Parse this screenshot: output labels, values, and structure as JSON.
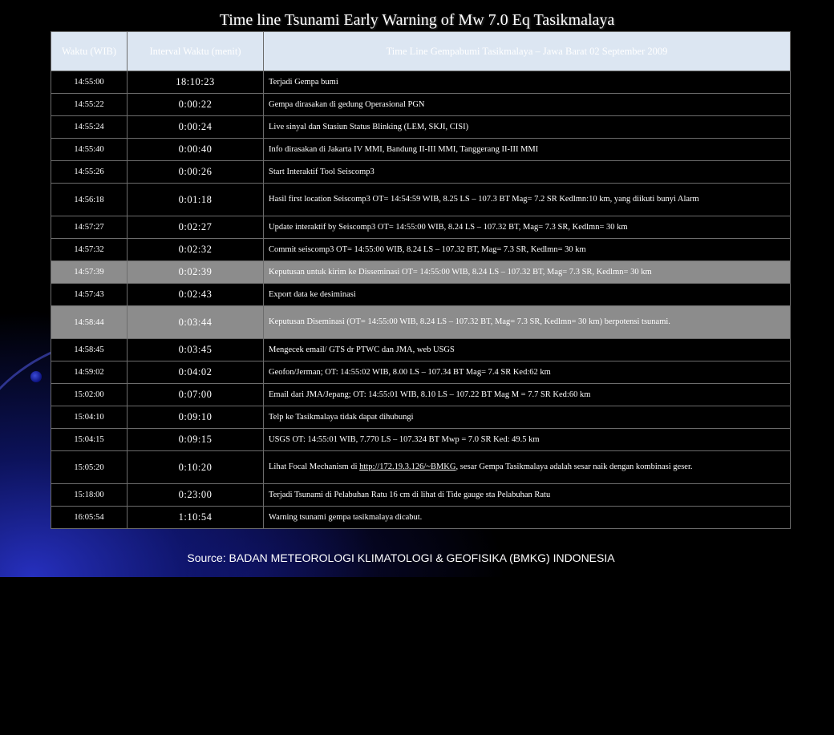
{
  "title": "Time line Tsunami Early Warning of Mw 7.0 Eq Tasikmalaya",
  "source": "Source: BADAN METEOROLOGI KLIMATOLOGI & GEOFISIKA  (BMKG) INDONESIA",
  "header": {
    "col_time": "Waktu (WIB)",
    "col_interval": "Interval Waktu (menit)",
    "col_event": "Time Line Gempabumi Tasikmalaya  – Jawa Barat 02 September 2009"
  },
  "rows": [
    {
      "time": "14:55:00",
      "interval": "18:10:23",
      "event": "Terjadi Gempa bumi"
    },
    {
      "time": "14:55:22",
      "interval": "0:00:22",
      "event": "Gempa dirasakan di gedung Operasional PGN"
    },
    {
      "time": "14:55:24",
      "interval": "0:00:24",
      "event": "Live sinyal dan Stasiun Status Blinking (LEM, SKJI, CISI)"
    },
    {
      "time": "14:55:40",
      "interval": "0:00:40",
      "event": "Info dirasakan di Jakarta IV MMI, Bandung II-III MMI, Tanggerang II-III MMI"
    },
    {
      "time": "14:55:26",
      "interval": "0:00:26",
      "event": "Start Interaktif Tool Seiscomp3"
    },
    {
      "time": "14:56:18",
      "interval": "0:01:18",
      "event": "Hasil first location Seiscomp3 OT= 14:54:59 WIB, 8.25 LS – 107.3 BT Mag= 7.2 SR Kedlmn:10 km, yang diikuti bunyi Alarm"
    },
    {
      "time": "14:57:27",
      "interval": "0:02:27",
      "event": "Update interaktif by Seiscomp3 OT= 14:55:00 WIB, 8.24 LS – 107.32 BT, Mag= 7.3 SR, Kedlmn= 30 km"
    },
    {
      "time": "14:57:32",
      "interval": "0:02:32",
      "event": "Commit seiscomp3 OT= 14:55:00 WIB, 8.24 LS – 107.32 BT, Mag= 7.3 SR, Kedlmn= 30 km"
    },
    {
      "time": "14:57:39",
      "interval": "0:02:39",
      "event": "Keputusan untuk kirim ke Disseminasi OT= 14:55:00 WIB, 8.24 LS – 107.32 BT, Mag= 7.3 SR, Kedlmn= 30 km"
    },
    {
      "time": "14:57:43",
      "interval": "0:02:43",
      "event": "Export data ke desiminasi"
    },
    {
      "time": "14:58:44",
      "interval": "0:03:44",
      "event": "Keputusan Diseminasi (OT= 14:55:00 WIB, 8.24 LS – 107.32 BT, Mag= 7.3 SR, Kedlmn= 30 km) berpotensi tsunami."
    },
    {
      "time": "14:58:45",
      "interval": "0:03:45",
      "event": "Mengecek email/ GTS dr PTWC dan JMA, web USGS"
    },
    {
      "time": "14:59:02",
      "interval": "0:04:02",
      "event": "Geofon/Jerman; OT: 14:55:02 WIB, 8.00 LS – 107.34 BT Mag= 7.4 SR Ked:62 km"
    },
    {
      "time": "15:02:00",
      "interval": "0:07:00",
      "event": "Email dari JMA/Jepang; OT: 14:55:01 WIB, 8.10 LS – 107.22 BT Mag M = 7.7 SR Ked:60  km"
    },
    {
      "time": "15:04:10",
      "interval": "0:09:10",
      "event": "Telp ke Tasikmalaya tidak dapat dihubungi"
    },
    {
      "time": "15:04:15",
      "interval": "0:09:15",
      "event": "USGS OT: 14:55:01 WIB, 7.770 LS – 107.324 BT Mwp = 7.0 SR Ked: 49.5 km"
    },
    {
      "time": "15:05:20",
      "interval": "0:10:20",
      "event_pre": "Lihat Focal Mechanism di ",
      "event_link": "http://172.19.3.126/~BMKG",
      "event_post": ", sesar Gempa Tasikmalaya adalah sesar naik dengan kombinasi geser."
    },
    {
      "time": "15:18:00",
      "interval": "0:23:00",
      "event": "Terjadi Tsunami di Pelabuhan Ratu 16 cm di lihat di Tide gauge sta Pelabuhan Ratu"
    },
    {
      "time": "16:05:54",
      "interval": "1:10:54",
      "event": "Warning tsunami gempa tasikmalaya dicabut."
    }
  ]
}
